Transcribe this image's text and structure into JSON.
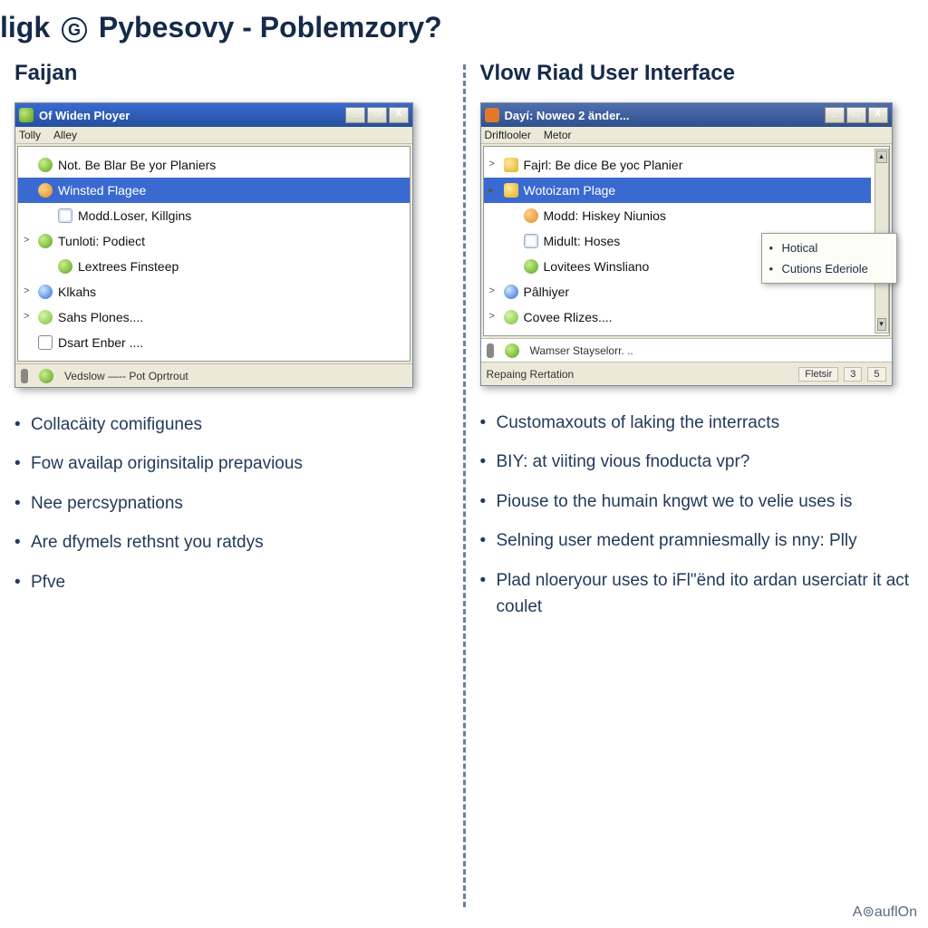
{
  "title_pre": "ligk",
  "title_post": "Pybesovy - Poblemzory?",
  "left": {
    "heading": "Faijan",
    "window_title": "Of Widen Ployer",
    "menus": [
      "Tolly",
      "Alley"
    ],
    "items": [
      {
        "label": "Not. Be Blar Be yor Planiers",
        "icon": "green",
        "expand": "",
        "sel": false
      },
      {
        "label": "Winsted Flagee",
        "icon": "orange",
        "expand": "",
        "sel": true
      },
      {
        "label": "Modd.Loser, Killgins",
        "icon": "doc",
        "expand": "",
        "sel": false,
        "indent": true
      },
      {
        "label": "Tunloti: Podiect",
        "icon": "green",
        "expand": ">",
        "sel": false
      },
      {
        "label": "Lextrees Finsteep",
        "icon": "green",
        "expand": "",
        "sel": false,
        "indent": true
      },
      {
        "label": "Klkahs",
        "icon": "globe",
        "expand": ">",
        "sel": false
      },
      {
        "label": "Sahs Plones....",
        "icon": "smile",
        "expand": ">",
        "sel": false
      },
      {
        "label": "Dsart Enber ....",
        "icon": "cal",
        "expand": "",
        "sel": false
      }
    ],
    "status_left": "Vedslow —--  Pot Oprtrout",
    "bullets": [
      "Collacäity comifigunes",
      "Fow availap originsitalip prepavious",
      "Nee percsypnations",
      "Are dfymels rethsnt you ratdys",
      "Pfve"
    ]
  },
  "right": {
    "heading": "Vlow Riad User Interface",
    "window_title": "Dayí: Noweo 2 änder...",
    "menus": [
      "Driftlooler",
      "Metor"
    ],
    "items": [
      {
        "label": "Fajrl: Be dice Be yoc Planier",
        "icon": "yellow",
        "expand": ">",
        "sel": false
      },
      {
        "label": "Wotoizam Plage",
        "icon": "yellow",
        "expand": "▸",
        "sel": true
      },
      {
        "label": "Modd: Hiskey Niunios",
        "icon": "orange",
        "expand": "",
        "sel": false,
        "indent": true
      },
      {
        "label": "Midult: Hoses",
        "icon": "doc",
        "expand": "",
        "sel": false,
        "indent": true
      },
      {
        "label": "Lovitees Winsliano",
        "icon": "green",
        "expand": "",
        "sel": false,
        "indent": true
      },
      {
        "label": "Pâlhiyer",
        "icon": "globe",
        "expand": ">",
        "sel": false
      },
      {
        "label": "Covee Rlizes....",
        "icon": "smile",
        "expand": ">",
        "sel": false
      }
    ],
    "status_items": [
      {
        "label": "Wamser Stayselorr. ..",
        "icon": "green"
      }
    ],
    "statusbar_left": "Repaing Rertation",
    "statusbar_right": [
      "Fletsir",
      "3",
      "5"
    ],
    "popup": [
      "Hotical",
      "Cutions Ederiole"
    ],
    "bullets": [
      "Customaxouts of laking the interracts",
      "BIY: at viiting vious fnoducta vpr?",
      "Piouse to the humain kngwt we to velie uses is",
      "Selning user medent pramniesmally is nny: Plly",
      "Plad nloeryour uses to iFl\"ënd ito ardan userciatr it act coulet"
    ]
  },
  "corner": "A⊚auflOn"
}
